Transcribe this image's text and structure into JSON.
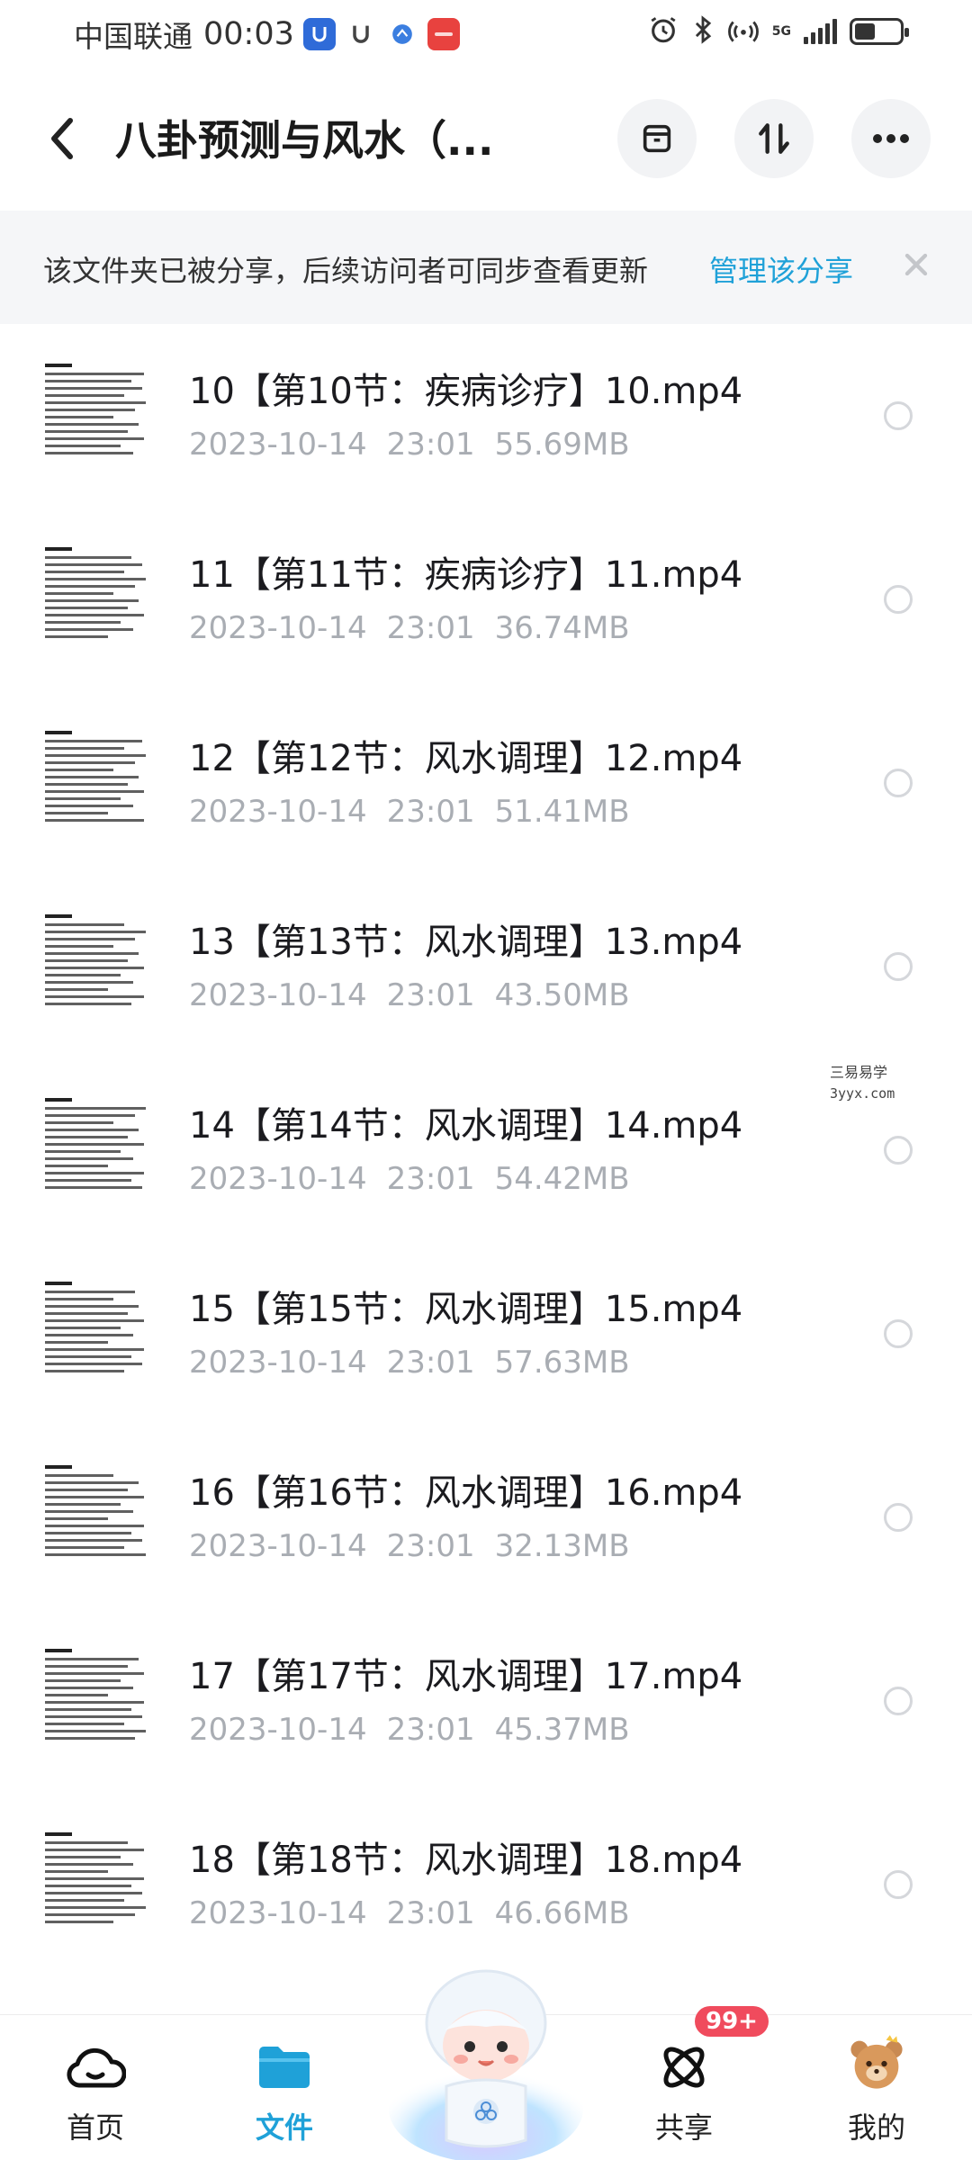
{
  "status_bar": {
    "carrier": "中国联通",
    "time": "00:03",
    "network": "5G",
    "battery_level": 0.45,
    "app_icon_colors": [
      "#2f6bd8",
      "#444444",
      "#3b7ee0",
      "#e8423f"
    ]
  },
  "header": {
    "title": "八卦预测与风水（...",
    "back_icon": "chevron-left-icon",
    "buttons": [
      "archive-icon",
      "sort-icon",
      "more-icon"
    ]
  },
  "banner": {
    "text": "该文件夹已被分享，后续访问者可同步查看更新",
    "link": "管理该分享",
    "link_color": "#1fa1d8"
  },
  "files": [
    {
      "name": "10【第10节：疾病诊疗】10.mp4",
      "date": "2023-10-14",
      "time": "23:01",
      "size": "55.69MB"
    },
    {
      "name": "11【第11节：疾病诊疗】11.mp4",
      "date": "2023-10-14",
      "time": "23:01",
      "size": "36.74MB"
    },
    {
      "name": "12【第12节：风水调理】12.mp4",
      "date": "2023-10-14",
      "time": "23:01",
      "size": "51.41MB"
    },
    {
      "name": "13【第13节：风水调理】13.mp4",
      "date": "2023-10-14",
      "time": "23:01",
      "size": "43.50MB"
    },
    {
      "name": "14【第14节：风水调理】14.mp4",
      "date": "2023-10-14",
      "time": "23:01",
      "size": "54.42MB"
    },
    {
      "name": "15【第15节：风水调理】15.mp4",
      "date": "2023-10-14",
      "time": "23:01",
      "size": "57.63MB"
    },
    {
      "name": "16【第16节：风水调理】16.mp4",
      "date": "2023-10-14",
      "time": "23:01",
      "size": "32.13MB"
    },
    {
      "name": "17【第17节：风水调理】17.mp4",
      "date": "2023-10-14",
      "time": "23:01",
      "size": "45.37MB"
    },
    {
      "name": "18【第18节：风水调理】18.mp4",
      "date": "2023-10-14",
      "time": "23:01",
      "size": "46.66MB"
    }
  ],
  "watermark": {
    "line1": "三易易学",
    "line2": "3yyx.com"
  },
  "bottom_nav": {
    "home": "首页",
    "files": "文件",
    "share": "共享",
    "share_badge": "99+",
    "mine": "我的",
    "active_color": "#1fa1d8",
    "badge_color": "#f04b5d"
  }
}
